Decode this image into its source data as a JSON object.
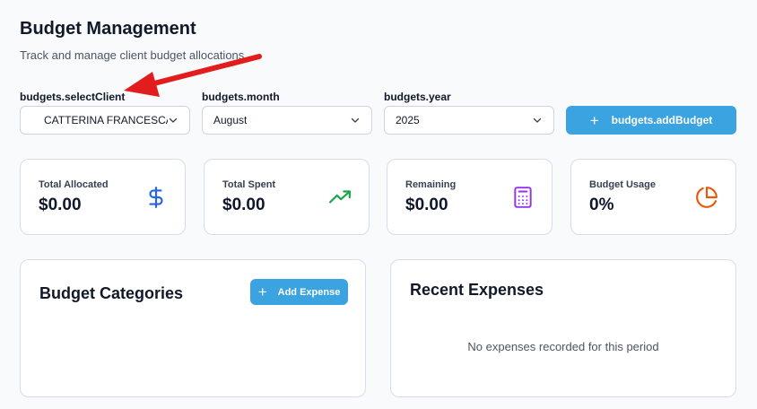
{
  "header": {
    "title": "Budget Management",
    "subtitle": "Track and manage client budget allocations"
  },
  "filters": {
    "client_label": "budgets.selectClient",
    "client_value": "CATTERINA FRANCESCA...",
    "month_label": "budgets.month",
    "month_value": "August",
    "year_label": "budgets.year",
    "year_value": "2025",
    "add_budget_label": "budgets.addBudget"
  },
  "stats": [
    {
      "label": "Total Allocated",
      "value": "$0.00",
      "icon": "dollar-sign-icon",
      "color": "#2563eb"
    },
    {
      "label": "Total Spent",
      "value": "$0.00",
      "icon": "trending-up-icon",
      "color": "#16a34a"
    },
    {
      "label": "Remaining",
      "value": "$0.00",
      "icon": "calculator-icon",
      "color": "#9333ea"
    },
    {
      "label": "Budget Usage",
      "value": "0%",
      "icon": "pie-chart-icon",
      "color": "#ea580c"
    }
  ],
  "categories_panel": {
    "title": "Budget Categories",
    "add_expense_label": "Add Expense"
  },
  "expenses_panel": {
    "title": "Recent Expenses",
    "empty_message": "No expenses recorded for this period"
  },
  "colors": {
    "accent": "#3aa3e0",
    "annotation_arrow": "#e11d1d"
  }
}
